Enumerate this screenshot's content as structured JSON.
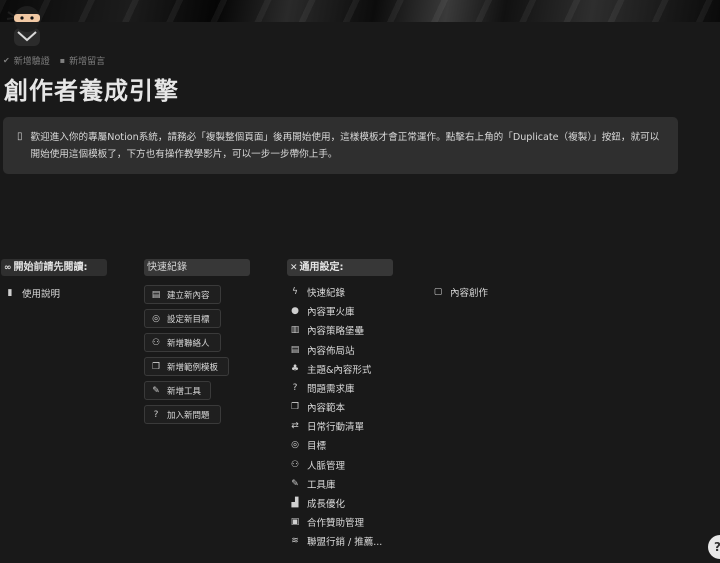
{
  "page": {
    "title": "創作者養成引擎",
    "icon": "ninja-avatar-icon",
    "meta": {
      "add_verification": "新增驗證",
      "add_comment": "新增留言"
    }
  },
  "callout": {
    "icon": "phone-icon",
    "text": "歡迎進入你的專屬Notion系統，請務必「複製整個頁面」後再開始使用，這樣模板才會正常運作。點擊右上角的「Duplicate（複製）」按鈕，就可以開始使用這個模板了，下方也有操作教學影片，可以一步一步帶你上手。"
  },
  "column_1": {
    "heading": "開始前請先閱讀:",
    "heading_icon": "infinity-icon",
    "links": [
      {
        "label": "使用說明",
        "icon": "book-icon"
      }
    ]
  },
  "column_2": {
    "heading": "快速紀錄",
    "buttons": [
      {
        "label": "建立新內容",
        "icon": "document-icon"
      },
      {
        "label": "設定新目標",
        "icon": "target-icon"
      },
      {
        "label": "新增聯絡人",
        "icon": "people-icon"
      },
      {
        "label": "新增範例模板",
        "icon": "copy-icon"
      },
      {
        "label": "新增工具",
        "icon": "wrench-icon"
      },
      {
        "label": "加入新問題",
        "icon": "question-icon"
      }
    ]
  },
  "column_3": {
    "heading": "通用設定:",
    "heading_icon": "tools-icon",
    "links": [
      {
        "label": "快速紀錄",
        "icon": "lightning-icon"
      },
      {
        "label": "內容軍火庫",
        "icon": "lightbulb-icon"
      },
      {
        "label": "內容策略堡壘",
        "icon": "map-icon"
      },
      {
        "label": "內容佈局站",
        "icon": "document-icon"
      },
      {
        "label": "主題&內容形式",
        "icon": "shapes-icon"
      },
      {
        "label": "問題需求庫",
        "icon": "question-icon"
      },
      {
        "label": "內容範本",
        "icon": "copy-icon"
      },
      {
        "label": "日常行動清單",
        "icon": "repeat-icon"
      },
      {
        "label": "目標",
        "icon": "target-icon"
      },
      {
        "label": "人脈管理",
        "icon": "people-icon"
      },
      {
        "label": "工具庫",
        "icon": "wrench-icon"
      },
      {
        "label": "成長優化",
        "icon": "chart-icon"
      },
      {
        "label": "合作贊助管理",
        "icon": "money-icon"
      },
      {
        "label": "聯盟行銷 / 推薦...",
        "icon": "wifi-icon"
      }
    ]
  },
  "column_4": {
    "links": [
      {
        "label": "內容創作",
        "icon": "page-outline-icon"
      }
    ]
  },
  "help": {
    "label": "?"
  }
}
